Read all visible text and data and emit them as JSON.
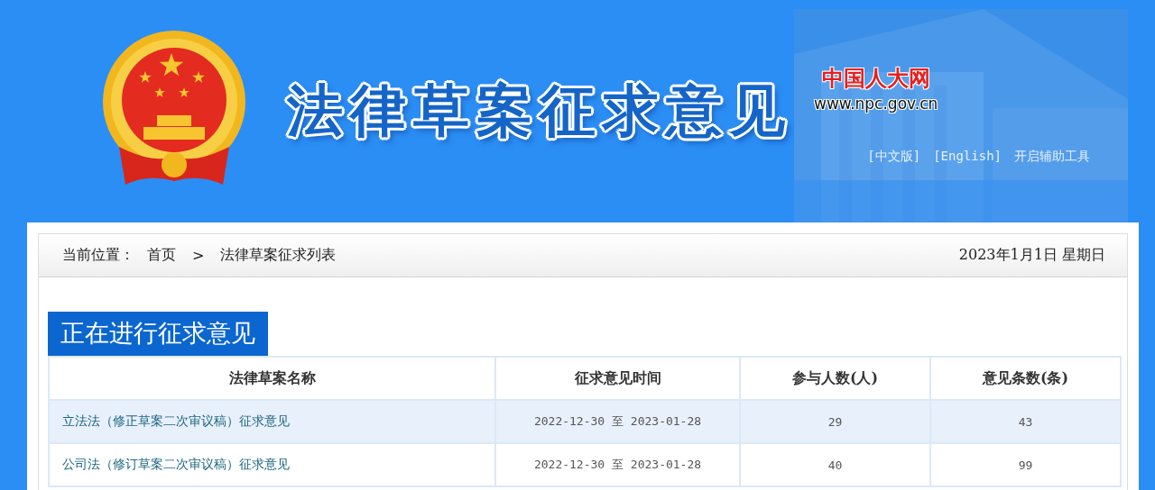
{
  "header": {
    "title": "法律草案征求意见",
    "site_name": "中国人大网",
    "site_url": "www.npc.gov.cn",
    "links": [
      "[中文版]",
      "[English]",
      "开启辅助工具"
    ]
  },
  "breadcrumb": {
    "label": "当前位置：",
    "items": [
      "首页",
      "法律草案征求列表"
    ],
    "separator": ">",
    "date": "2023年1月1日  星期日"
  },
  "section_title": "正在进行征求意见",
  "table": {
    "columns": [
      "法律草案名称",
      "征求意见时间",
      "参与人数(人)",
      "意见条数(条)"
    ],
    "rows": [
      {
        "name": "立法法（修正草案二次审议稿）征求意见",
        "period": "2022-12-30 至 2023-01-28",
        "participants": "29",
        "opinions": "43"
      },
      {
        "name": "公司法（修订草案二次审议稿）征求意见",
        "period": "2022-12-30 至 2023-01-28",
        "participants": "40",
        "opinions": "99"
      }
    ]
  }
}
